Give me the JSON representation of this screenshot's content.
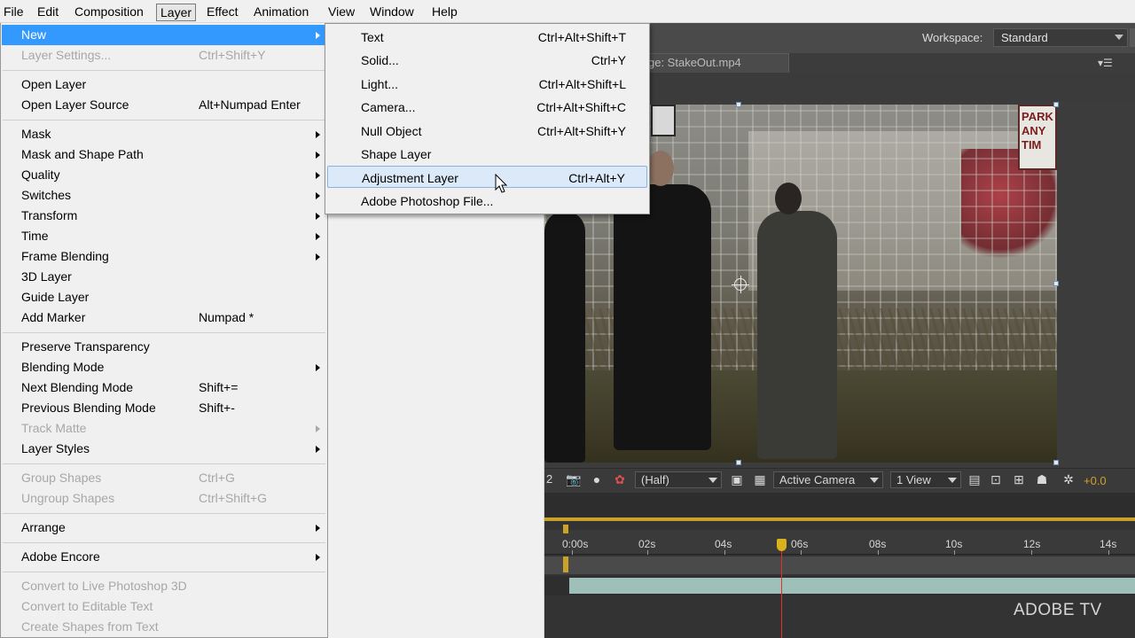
{
  "menubar": {
    "items": [
      "File",
      "Edit",
      "Composition",
      "Layer",
      "Effect",
      "Animation",
      "View",
      "Window",
      "Help"
    ],
    "active": "Layer"
  },
  "workspace": {
    "label": "Workspace:",
    "value": "Standard"
  },
  "viewer": {
    "tab_title": "ge: StakeOut.mp4",
    "panel_menu_icon": "panel-menu-icon",
    "toolbar": {
      "magnification_partial": "2",
      "resolution": "(Half)",
      "camera": "Active Camera",
      "views": "1 View",
      "exposure": "+0.0"
    },
    "sign_text": "PARK ANY TIM"
  },
  "timeline": {
    "ticks": [
      "0:00s",
      "02s",
      "04s",
      "06s",
      "08s",
      "10s",
      "12s",
      "14s"
    ],
    "playhead_time_s": 6.0
  },
  "watermark": "ADOBE TV",
  "layer_menu": {
    "items": [
      {
        "label": "New",
        "shortcut": "",
        "submenu": true,
        "highlighted": true,
        "disabled": false
      },
      {
        "label": "Layer Settings...",
        "shortcut": "Ctrl+Shift+Y",
        "submenu": false,
        "disabled": true
      },
      {
        "sep": true
      },
      {
        "label": "Open Layer",
        "shortcut": "",
        "submenu": false,
        "disabled": false
      },
      {
        "label": "Open Layer Source",
        "shortcut": "Alt+Numpad Enter",
        "submenu": false,
        "disabled": false
      },
      {
        "sep": true
      },
      {
        "label": "Mask",
        "shortcut": "",
        "submenu": true,
        "disabled": false
      },
      {
        "label": "Mask and Shape Path",
        "shortcut": "",
        "submenu": true,
        "disabled": false
      },
      {
        "label": "Quality",
        "shortcut": "",
        "submenu": true,
        "disabled": false
      },
      {
        "label": "Switches",
        "shortcut": "",
        "submenu": true,
        "disabled": false
      },
      {
        "label": "Transform",
        "shortcut": "",
        "submenu": true,
        "disabled": false
      },
      {
        "label": "Time",
        "shortcut": "",
        "submenu": true,
        "disabled": false
      },
      {
        "label": "Frame Blending",
        "shortcut": "",
        "submenu": true,
        "disabled": false
      },
      {
        "label": "3D Layer",
        "shortcut": "",
        "submenu": false,
        "disabled": false
      },
      {
        "label": "Guide Layer",
        "shortcut": "",
        "submenu": false,
        "disabled": false
      },
      {
        "label": "Add Marker",
        "shortcut": "Numpad *",
        "submenu": false,
        "disabled": false
      },
      {
        "sep": true
      },
      {
        "label": "Preserve Transparency",
        "shortcut": "",
        "submenu": false,
        "disabled": false
      },
      {
        "label": "Blending Mode",
        "shortcut": "",
        "submenu": true,
        "disabled": false
      },
      {
        "label": "Next Blending Mode",
        "shortcut": "Shift+=",
        "submenu": false,
        "disabled": false
      },
      {
        "label": "Previous Blending Mode",
        "shortcut": "Shift+-",
        "submenu": false,
        "disabled": false
      },
      {
        "label": "Track Matte",
        "shortcut": "",
        "submenu": true,
        "disabled": true
      },
      {
        "label": "Layer Styles",
        "shortcut": "",
        "submenu": true,
        "disabled": false
      },
      {
        "sep": true
      },
      {
        "label": "Group Shapes",
        "shortcut": "Ctrl+G",
        "submenu": false,
        "disabled": true
      },
      {
        "label": "Ungroup Shapes",
        "shortcut": "Ctrl+Shift+G",
        "submenu": false,
        "disabled": true
      },
      {
        "sep": true
      },
      {
        "label": "Arrange",
        "shortcut": "",
        "submenu": true,
        "disabled": false
      },
      {
        "sep": true
      },
      {
        "label": "Adobe Encore",
        "shortcut": "",
        "submenu": true,
        "disabled": false
      },
      {
        "sep": true
      },
      {
        "label": "Convert to Live Photoshop 3D",
        "shortcut": "",
        "submenu": false,
        "disabled": true
      },
      {
        "label": "Convert to Editable Text",
        "shortcut": "",
        "submenu": false,
        "disabled": true
      },
      {
        "label": "Create Shapes from Text",
        "shortcut": "",
        "submenu": false,
        "disabled": true
      }
    ]
  },
  "new_submenu": {
    "items": [
      {
        "label": "Text",
        "shortcut": "Ctrl+Alt+Shift+T"
      },
      {
        "label": "Solid...",
        "shortcut": "Ctrl+Y"
      },
      {
        "label": "Light...",
        "shortcut": "Ctrl+Alt+Shift+L"
      },
      {
        "label": "Camera...",
        "shortcut": "Ctrl+Alt+Shift+C"
      },
      {
        "label": "Null Object",
        "shortcut": "Ctrl+Alt+Shift+Y"
      },
      {
        "label": "Shape Layer",
        "shortcut": ""
      },
      {
        "label": "Adjustment Layer",
        "shortcut": "Ctrl+Alt+Y",
        "highlighted": true
      },
      {
        "label": "Adobe Photoshop File...",
        "shortcut": ""
      }
    ]
  }
}
